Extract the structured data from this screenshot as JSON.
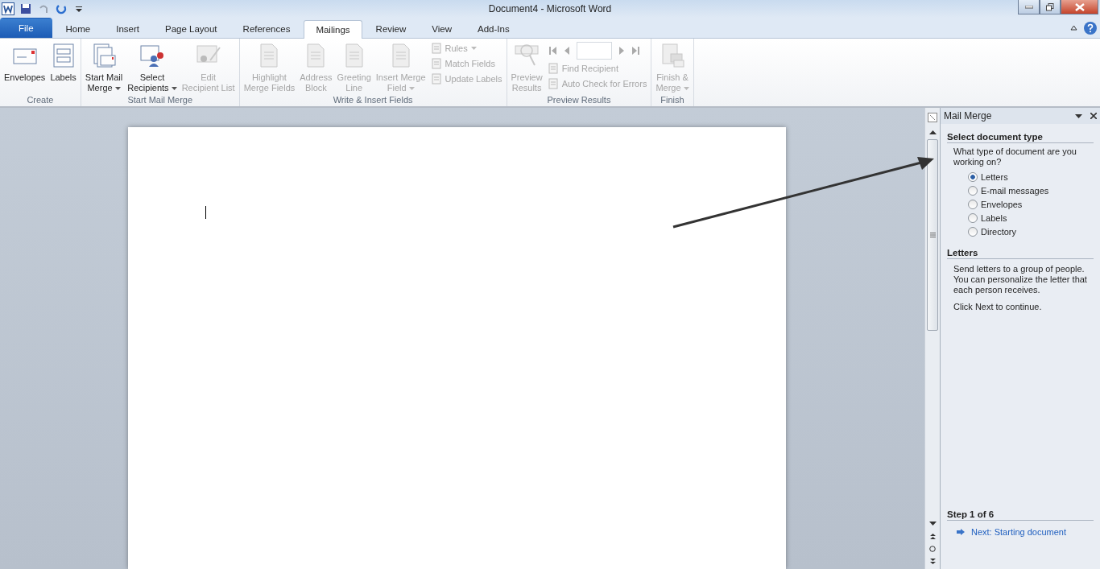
{
  "window": {
    "title": "Document4  -  Microsoft Word"
  },
  "tabs": [
    {
      "label": "File",
      "kind": "file",
      "selected": false
    },
    {
      "label": "Home",
      "kind": "normal",
      "selected": false
    },
    {
      "label": "Insert",
      "kind": "normal",
      "selected": false
    },
    {
      "label": "Page Layout",
      "kind": "normal",
      "selected": false
    },
    {
      "label": "References",
      "kind": "normal",
      "selected": false
    },
    {
      "label": "Mailings",
      "kind": "normal",
      "selected": true
    },
    {
      "label": "Review",
      "kind": "normal",
      "selected": false
    },
    {
      "label": "View",
      "kind": "normal",
      "selected": false
    },
    {
      "label": "Add-Ins",
      "kind": "normal",
      "selected": false
    }
  ],
  "ribbon_groups": [
    {
      "label": "Create",
      "items": [
        {
          "kind": "large",
          "lines": [
            "Envelopes"
          ],
          "disabled": false,
          "dropdown": false
        },
        {
          "kind": "large",
          "lines": [
            "Labels"
          ],
          "disabled": false,
          "dropdown": false
        }
      ]
    },
    {
      "label": "Start Mail Merge",
      "items": [
        {
          "kind": "large",
          "lines": [
            "Start Mail",
            "Merge"
          ],
          "disabled": false,
          "dropdown": true
        },
        {
          "kind": "large",
          "lines": [
            "Select",
            "Recipients"
          ],
          "disabled": false,
          "dropdown": true
        },
        {
          "kind": "large",
          "lines": [
            "Edit",
            "Recipient List"
          ],
          "disabled": true,
          "dropdown": false
        }
      ]
    },
    {
      "label": "Write & Insert Fields",
      "items": [
        {
          "kind": "large",
          "lines": [
            "Highlight",
            "Merge Fields"
          ],
          "disabled": true,
          "dropdown": false
        },
        {
          "kind": "large",
          "lines": [
            "Address",
            "Block"
          ],
          "disabled": true,
          "dropdown": false
        },
        {
          "kind": "large",
          "lines": [
            "Greeting",
            "Line"
          ],
          "disabled": true,
          "dropdown": false
        },
        {
          "kind": "large",
          "lines": [
            "Insert Merge",
            "Field"
          ],
          "disabled": true,
          "dropdown": true
        },
        {
          "kind": "stack",
          "items": [
            {
              "label": "Rules",
              "disabled": true,
              "dropdown": true
            },
            {
              "label": "Match Fields",
              "disabled": true,
              "dropdown": false
            },
            {
              "label": "Update Labels",
              "disabled": true,
              "dropdown": false
            }
          ]
        }
      ]
    },
    {
      "label": "Preview Results",
      "items": [
        {
          "kind": "large",
          "lines": [
            "Preview",
            "Results"
          ],
          "disabled": true,
          "dropdown": false
        },
        {
          "kind": "nav",
          "items": [
            {
              "label": "Find Recipient",
              "disabled": true,
              "dropdown": false
            },
            {
              "label": "Auto Check for Errors",
              "disabled": true,
              "dropdown": false
            }
          ]
        }
      ]
    },
    {
      "label": "Finish",
      "items": [
        {
          "kind": "large",
          "lines": [
            "Finish &",
            "Merge"
          ],
          "disabled": true,
          "dropdown": true
        }
      ]
    }
  ],
  "task_pane": {
    "title": "Mail Merge",
    "sections": [
      {
        "heading": "Select document type",
        "question": "What type of document are you working on?",
        "options": [
          {
            "label": "Letters",
            "selected": true
          },
          {
            "label": "E-mail messages",
            "selected": false
          },
          {
            "label": "Envelopes",
            "selected": false
          },
          {
            "label": "Labels",
            "selected": false
          },
          {
            "label": "Directory",
            "selected": false
          }
        ]
      },
      {
        "heading": "Letters",
        "paragraphs": [
          "Send letters to a group of people. You can personalize the letter that each person receives.",
          "Click Next to continue."
        ]
      }
    ],
    "step": {
      "heading": "Step 1 of 6",
      "link": "Next: Starting document"
    }
  }
}
